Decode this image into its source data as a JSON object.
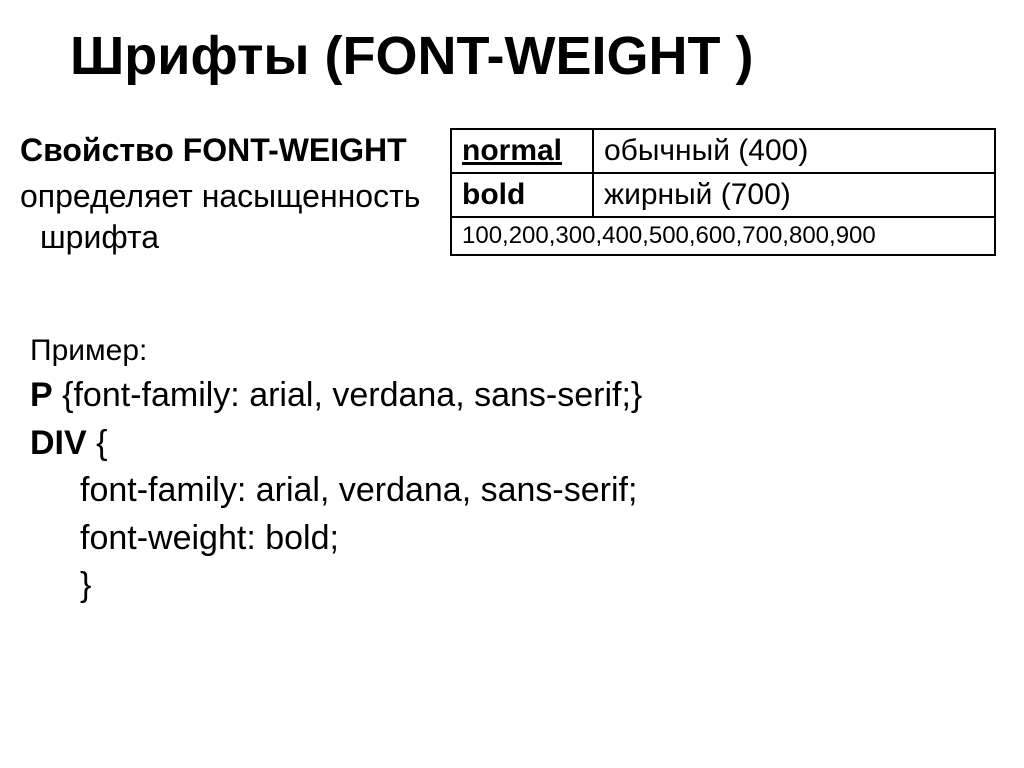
{
  "title": "Шрифты (FONT-WEIGHT )",
  "property_label": "Свойство FONT-WEIGHT",
  "property_desc": "определяет насыщенность шрифта",
  "table": {
    "row1_key": "normal",
    "row1_val": "обычный (400)",
    "row2_key": "bold",
    "row2_val": "жирный (700)",
    "row3": "100,200,300,400,500,600,700,800,900"
  },
  "example": {
    "label": "Пример:",
    "p_sel": "P",
    "p_body": " {font-family: arial, verdana, sans-serif;}",
    "div_sel": "DIV",
    "div_open": " {",
    "div_l1": "font-family: arial, verdana, sans-serif;",
    "div_l2": "font-weight: bold;",
    "div_close": "}"
  }
}
